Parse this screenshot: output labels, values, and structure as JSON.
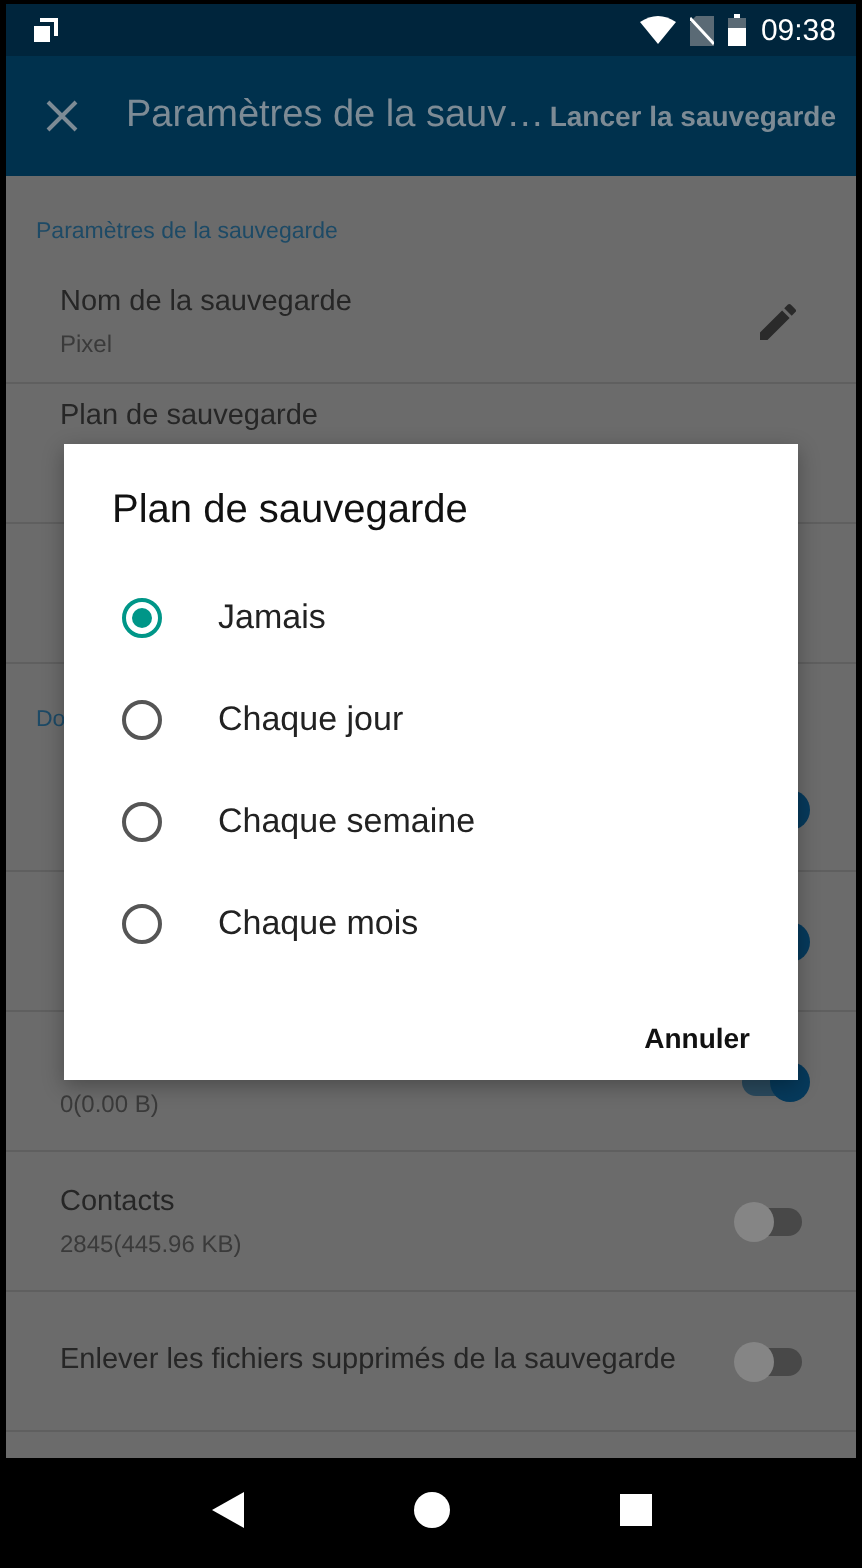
{
  "status_bar": {
    "time": "09:38"
  },
  "app_bar": {
    "title": "Paramètres de la sauv…",
    "action": "Lancer la sauvegarde"
  },
  "sections": [
    {
      "header": "Paramètres de la sauvegarde",
      "rows": [
        {
          "kind": "edit",
          "title": "Nom de la sauvegarde",
          "subtitle": "Pixel"
        },
        {
          "kind": "plain",
          "title": "Plan de sauvegarde"
        },
        {
          "kind": "plain"
        }
      ]
    },
    {
      "header": "Do",
      "rows": [
        {
          "kind": "toggle",
          "on": true
        },
        {
          "kind": "toggle",
          "on": true
        },
        {
          "kind": "toggle",
          "on": true,
          "subtitle": "0(0.00 B)"
        },
        {
          "kind": "toggle",
          "title": "Contacts",
          "subtitle": "2845(445.96 KB)",
          "on": false
        },
        {
          "kind": "toggle",
          "title": "Enlever les fichiers supprimés de la sauvegarde",
          "on": false
        }
      ]
    }
  ],
  "dialog": {
    "title": "Plan de sauvegarde",
    "options": [
      {
        "label": "Jamais",
        "selected": true
      },
      {
        "label": "Chaque jour",
        "selected": false
      },
      {
        "label": "Chaque semaine",
        "selected": false
      },
      {
        "label": "Chaque mois",
        "selected": false
      }
    ],
    "button": "Annuler"
  }
}
